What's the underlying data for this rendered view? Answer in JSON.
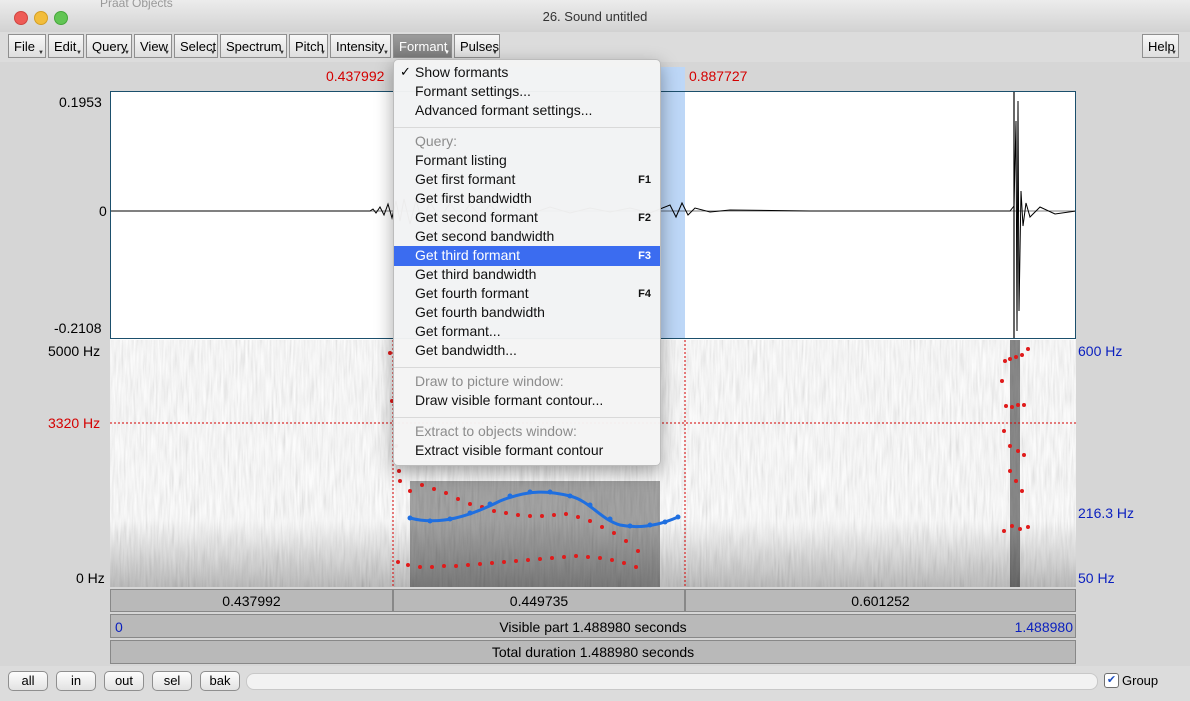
{
  "window": {
    "title": "26. Sound untitled",
    "behind_title": "Praat Objects"
  },
  "menubar": {
    "items": [
      "File",
      "Edit",
      "Query",
      "View",
      "Select",
      "Spectrum",
      "Pitch",
      "Intensity",
      "Formant",
      "Pulses"
    ],
    "help": "Help",
    "active": "Formant"
  },
  "selection": {
    "start": "0.437992",
    "end": "0.887727"
  },
  "waveform": {
    "ymax": "0.1953",
    "yzero": "0",
    "ymin": "-0.2108"
  },
  "spectrogram": {
    "fmax": "5000 Hz",
    "fcursor": "3320 Hz",
    "fmin": "0 Hz",
    "pitch_max": "600 Hz",
    "pitch_mid": "216.3 Hz",
    "pitch_min": "50 Hz"
  },
  "segments": [
    "0.437992",
    "0.449735",
    "0.601252"
  ],
  "visible": {
    "start": "0",
    "label": "Visible part 1.488980 seconds",
    "end": "1.488980"
  },
  "total": {
    "label": "Total duration 1.488980 seconds"
  },
  "bottom": {
    "buttons": [
      "all",
      "in",
      "out",
      "sel",
      "bak"
    ],
    "group_label": "Group",
    "group_checked": true
  },
  "formant_menu": {
    "show_formants": "Show formants",
    "formant_settings": "Formant settings...",
    "advanced_settings": "Advanced formant settings...",
    "query_header": "Query:",
    "formant_listing": "Formant listing",
    "get_first_formant": "Get first formant",
    "get_first_bandwidth": "Get first bandwidth",
    "get_second_formant": "Get second formant",
    "get_second_bandwidth": "Get second bandwidth",
    "get_third_formant": "Get third formant",
    "get_third_bandwidth": "Get third bandwidth",
    "get_fourth_formant": "Get fourth formant",
    "get_fourth_bandwidth": "Get fourth bandwidth",
    "get_formant": "Get formant...",
    "get_bandwidth": "Get bandwidth...",
    "draw_header": "Draw to picture window:",
    "draw_contour": "Draw visible formant contour...",
    "extract_header": "Extract to objects window:",
    "extract_contour": "Extract visible formant contour",
    "shortcuts": {
      "f1": "F1",
      "f2": "F2",
      "f3": "F3",
      "f4": "F4"
    },
    "highlighted": "Get third formant"
  },
  "colors": {
    "selection": "#bdd7f7",
    "formant_dots": "#e01b1b",
    "pitch_line": "#1f6fe0",
    "highlight": "#3b6cf0"
  }
}
